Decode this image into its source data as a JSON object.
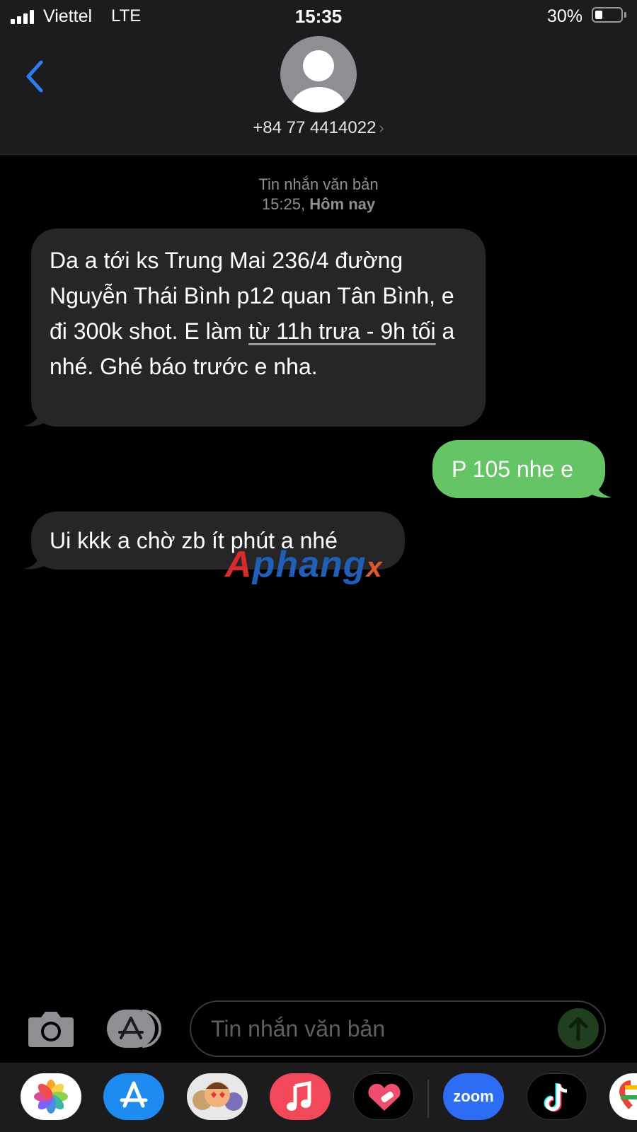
{
  "status_bar": {
    "carrier": "Viettel",
    "network": "LTE",
    "time": "15:35",
    "battery_percent": "30%",
    "battery_level": 0.3
  },
  "header": {
    "back_icon": "chevron-left-icon",
    "contact_icon": "person-avatar-icon",
    "contact_number": "+84 77 4414022",
    "contact_chevron": "›"
  },
  "conversation": {
    "message_kind": "Tin nhắn văn bản",
    "time_prefix": "15:25,",
    "day_label": "Hôm nay",
    "messages": [
      {
        "direction": "incoming",
        "text_before_link": "Da a tới ks Trung Mai 236/4  đường Nguyễn Thái Bình p12 quan Tân Bình, e đi 300k shot. E làm ",
        "link_text": "từ 11h trưa - 9h tối",
        "text_after_link": " a nhé. Ghé báo trước e nha."
      },
      {
        "direction": "outgoing",
        "text": "P 105 nhe e"
      },
      {
        "direction": "incoming",
        "text": "Ui kkk a chờ zb ít phút a nhé"
      }
    ],
    "watermark": {
      "part1": "A",
      "part2": "phang",
      "part3": "x"
    }
  },
  "input_bar": {
    "camera_icon": "camera-icon",
    "apps_icon": "app-store-icon",
    "placeholder": "Tin nhắn văn bản",
    "send_icon": "send-arrow-icon"
  },
  "app_drawer": {
    "apps": [
      "photos-icon",
      "app-store-icon",
      "memoji-icon",
      "music-icon",
      "fitness-heart-icon",
      "zoom-icon",
      "tiktok-icon",
      "maps-icon"
    ],
    "zoom_label": "zoom"
  },
  "colors": {
    "outgoing_bubble": "#65c466",
    "incoming_bubble": "#262628",
    "accent_blue": "#2f7cf6",
    "header_bg": "#1c1c1e"
  }
}
